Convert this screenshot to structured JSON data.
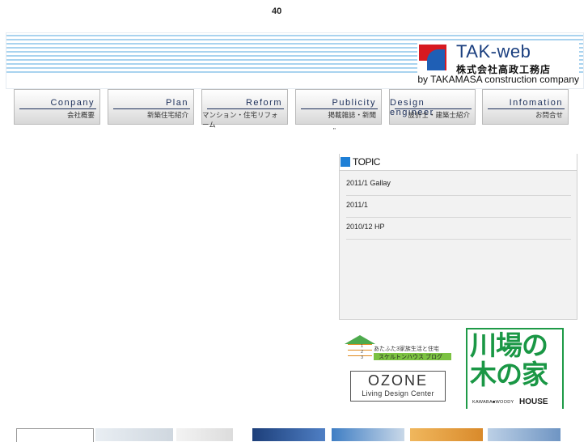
{
  "top_number": "40",
  "header": {
    "logo_title": "TAK-web",
    "logo_subtitle": "株式会社高政工務店",
    "logo_byline": "by TAKAMASA construction company",
    "colors": {
      "stripe": "#a9d3ef",
      "mark_red": "#d71920",
      "mark_blue": "#1f5fb5"
    }
  },
  "nav": [
    {
      "en": "Conpany",
      "jp": "会社概要"
    },
    {
      "en": "Plan",
      "jp": "新築住宅紹介"
    },
    {
      "en": "Reform",
      "jp": "マンション・住宅リフォーム"
    },
    {
      "en": "Publicity",
      "jp": "掲載雑誌・新聞"
    },
    {
      "en": "Design engineer",
      "jp": "設計士・建築士紹介"
    },
    {
      "en": "Infomation",
      "jp": "お問合せ"
    }
  ],
  "tiny_mark": "\"",
  "topic": {
    "title": "TOPIC",
    "items": [
      "2011/1 Gallay",
      "2011/1",
      "2010/12 HP"
    ],
    "accent": "#1e7fd6"
  },
  "banners": {
    "skeleton": {
      "line1": "あたふた3家族生活と住宅",
      "line2": "スケルトンハウス ブログ",
      "nums": [
        "1",
        "2",
        "3"
      ]
    },
    "ozone": {
      "title": "OZONE",
      "subtitle": "Living Design Center"
    },
    "kawaba": {
      "line1": "川場の",
      "line2": "木の家",
      "footer_en": "KAWABA■WOODY",
      "footer_house": "HOUSE",
      "color": "#1a9745"
    }
  }
}
